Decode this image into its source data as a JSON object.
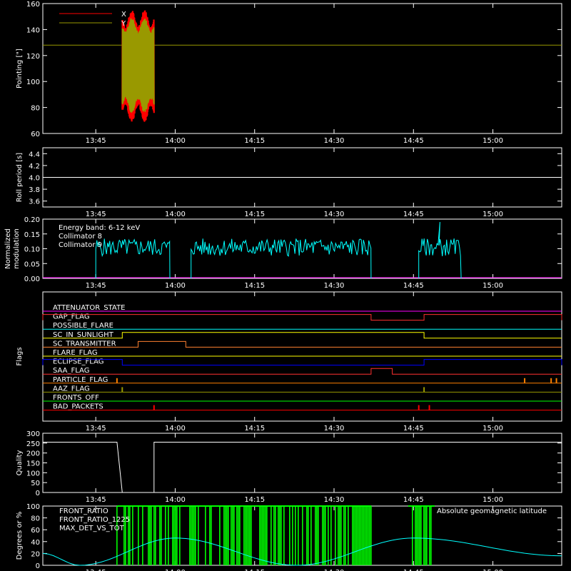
{
  "time_ticks": [
    "13:45",
    "14:00",
    "14:15",
    "14:30",
    "14:45",
    "15:00"
  ],
  "chart_data": [
    {
      "type": "line",
      "ylabel": "Pointing [\"]",
      "ylim": [
        60,
        160
      ],
      "yticks": [
        60,
        80,
        100,
        120,
        140,
        160
      ],
      "legend": [
        {
          "name": "X",
          "color": "#ff0000"
        },
        {
          "name": "Y",
          "color": "#999900"
        }
      ],
      "reference_line": {
        "value": 128,
        "color": "#999900"
      },
      "series": [
        {
          "name": "X",
          "color": "#ff0000",
          "x_range": [
            "13:50",
            "13:56"
          ],
          "ymin": 68,
          "ymax": 156
        },
        {
          "name": "Y",
          "color": "#999900",
          "x_range": [
            "13:50",
            "13:56"
          ],
          "ymin": 75,
          "ymax": 150
        }
      ]
    },
    {
      "type": "line",
      "ylabel": "Roll period [s]",
      "ylim": [
        3.5,
        4.5
      ],
      "yticks": [
        "3.6",
        "3.8",
        "4.0",
        "4.2",
        "4.4"
      ],
      "series": [
        {
          "color": "#ffffff",
          "x": [
            "13:35",
            "15:13"
          ],
          "y": [
            4.0,
            4.0
          ]
        }
      ]
    },
    {
      "type": "line",
      "ylabel": [
        "Normalized",
        "modulation"
      ],
      "ylim": [
        0,
        0.2
      ],
      "yticks": [
        "0.00",
        "0.05",
        "0.10",
        "0.15",
        "0.20"
      ],
      "legend_title": "Energy band: 6-12 keV",
      "legend": [
        {
          "name": "Collimator 8",
          "color": "#00ffff"
        },
        {
          "name": "Collimator 9",
          "color": "#ff00ff"
        }
      ],
      "series": [
        {
          "name": "Collimator 8",
          "color": "#00ffff",
          "active_intervals": [
            [
              "13:45",
              "13:59"
            ],
            [
              "14:03",
              "14:37"
            ],
            [
              "14:46",
              "14:54"
            ]
          ],
          "mean": 0.105,
          "spread": 0.03,
          "peak": {
            "x": "14:50",
            "y": 0.19
          }
        },
        {
          "name": "Collimator 9",
          "color": "#ff00ff",
          "x": [
            "13:35",
            "15:13"
          ],
          "y": [
            0.0,
            0.0
          ]
        }
      ]
    },
    {
      "type": "line",
      "ylabel": "Flags",
      "flags": [
        {
          "name": "ATTENUATOR_STATE",
          "color": "#ff00ff",
          "high": []
        },
        {
          "name": "GAP_FLAG",
          "color": "#ff3030",
          "high": [
            [
              "13:35",
              "14:37"
            ],
            [
              "14:47",
              "15:13"
            ]
          ]
        },
        {
          "name": "POSSIBLE_FLARE",
          "color": "#00ffff",
          "high": []
        },
        {
          "name": "SC_IN_SUNLIGHT",
          "color": "#ffff00",
          "high": [
            [
              "13:50",
              "14:47"
            ]
          ]
        },
        {
          "name": "SC_TRANSMITTER",
          "color": "#ff8030",
          "high": [
            [
              "13:53",
              "14:02"
            ]
          ]
        },
        {
          "name": "FLARE_FLAG",
          "color": "#ffff00",
          "high": []
        },
        {
          "name": "ECLIPSE_FLAG",
          "color": "#0000ff",
          "high": [
            [
              "13:35",
              "13:50"
            ],
            [
              "14:47",
              "15:13"
            ]
          ]
        },
        {
          "name": "SAA_FLAG",
          "color": "#ff3030",
          "high": [
            [
              "14:37",
              "14:41"
            ]
          ]
        },
        {
          "name": "PARTICLE_FLAG",
          "color": "#ff8000",
          "spikes": [
            "13:49",
            "15:06",
            "15:11",
            "15:12"
          ]
        },
        {
          "name": "AAZ_FLAG",
          "color": "#999900",
          "spikes": [
            "13:50",
            "14:47"
          ]
        },
        {
          "name": "FRONTS_OFF",
          "color": "#00ff00",
          "spikes": []
        },
        {
          "name": "BAD_PACKETS",
          "color": "#ff0000",
          "spikes": [
            "13:56",
            "14:46",
            "14:48"
          ]
        }
      ]
    },
    {
      "type": "line",
      "ylabel": "Quality",
      "ylim": [
        0,
        300
      ],
      "yticks": [
        "0",
        "50",
        "100",
        "150",
        "200",
        "250",
        "300"
      ],
      "series": [
        {
          "color": "#ffffff",
          "x": [
            "13:35",
            "13:49",
            "13:50",
            "13:56",
            "13:56",
            "15:13"
          ],
          "y": [
            255,
            255,
            0,
            0,
            255,
            255
          ]
        }
      ]
    },
    {
      "type": "line",
      "ylabel": "Degrees or %",
      "ylim": [
        0,
        100
      ],
      "yticks": [
        "0",
        "20",
        "40",
        "60",
        "80",
        "100"
      ],
      "legend": [
        {
          "name": "FRONT_RATIO",
          "color": "#ffff00"
        },
        {
          "name": "FRONT_RATIO_1225",
          "color": "#00ff00"
        },
        {
          "name": "MAX_DET_VS_TOT",
          "color": "#ff8030"
        }
      ],
      "legend_right": {
        "name": "Absolute geomagnetic latitude",
        "color": "#00ffff"
      },
      "series": [
        {
          "name": "FRONT_RATIO_1225",
          "color": "#00ff00",
          "active_intervals": [
            [
              "13:49",
              "14:37"
            ],
            [
              "14:44",
              "14:49"
            ]
          ],
          "value": 100
        },
        {
          "name": "Absolute geomagnetic latitude",
          "color": "#00ffff",
          "x": [
            "13:35",
            "13:42",
            "14:00",
            "14:23",
            "14:45",
            "15:13"
          ],
          "y": [
            20,
            0,
            46,
            0,
            46,
            16
          ]
        }
      ]
    }
  ]
}
